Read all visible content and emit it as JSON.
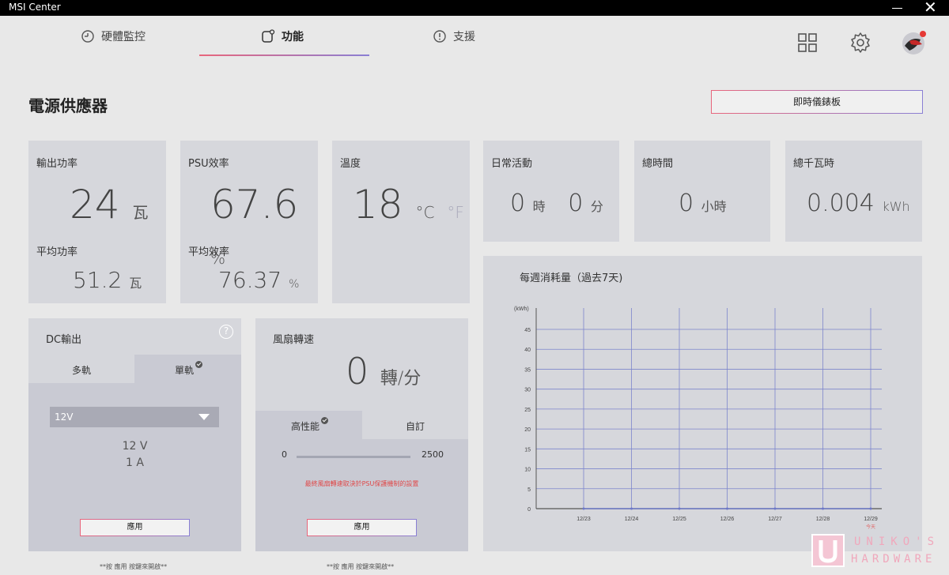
{
  "window": {
    "title": "MSI Center"
  },
  "nav": {
    "tabs": [
      {
        "label": "硬體監控",
        "icon": "gauge-icon"
      },
      {
        "label": "功能",
        "icon": "features-icon",
        "active": true
      },
      {
        "label": "支援",
        "icon": "support-icon"
      }
    ],
    "right_icons": [
      "apps-grid-icon",
      "settings-gear-icon",
      "user-avatar-icon"
    ]
  },
  "page": {
    "title": "電源供應器",
    "dashboard_button": "即時儀錶板"
  },
  "output_power": {
    "label": "輸出功率",
    "value": "24",
    "unit": "瓦",
    "avg_label": "平均功率",
    "avg_value": "51.2",
    "avg_unit": "瓦"
  },
  "psu_efficiency": {
    "label": "PSU效率",
    "value": "67.6",
    "unit": "%",
    "avg_label": "平均效率",
    "avg_value": "76.37",
    "avg_unit": "%"
  },
  "temperature": {
    "label": "溫度",
    "value": "18",
    "unit_c": "°C",
    "unit_f": "°F"
  },
  "daily_activity": {
    "label": "日常活動",
    "hours": "0",
    "hours_unit": "時",
    "minutes": "0",
    "minutes_unit": "分"
  },
  "total_time": {
    "label": "總時間",
    "value": "0",
    "unit": "小時"
  },
  "total_kwh": {
    "label": "總千瓦時",
    "value": "0.004",
    "unit": "kWh"
  },
  "dc_output": {
    "label": "DC輸出",
    "tabs": [
      "多軌",
      "單軌"
    ],
    "selected_tab": "單軌",
    "rail_select": "12V",
    "voltage": "12 V",
    "current": "1 A",
    "apply": "應用",
    "note": "**按 應用 按鍵來開啟**"
  },
  "fan_speed": {
    "label": "風扇轉速",
    "value": "0",
    "unit": "轉/分",
    "tabs": [
      "高性能",
      "自訂"
    ],
    "selected_tab": "高性能",
    "slider_min": "0",
    "slider_max": "2500",
    "warning": "最終風扇轉速取決於PSU保護機制的設置",
    "apply": "應用",
    "note": "**按 應用 按鍵來開啟**"
  },
  "accent_colors": {
    "pink": "#e8667c",
    "violet": "#8a7fd4",
    "warning": "#e04848",
    "chart_line": "#6d78c8"
  },
  "chart_data": {
    "type": "line",
    "title": "每週消耗量（過去7天)",
    "ylabel": "(kWh)",
    "xlabel": "",
    "x": [
      "12/23",
      "12/24",
      "12/25",
      "12/26",
      "12/27",
      "12/28",
      "12/29"
    ],
    "today_label": "今天",
    "y_ticks": [
      "0",
      "5",
      "10",
      "15",
      "20",
      "25",
      "30",
      "35",
      "40",
      "45"
    ],
    "ylim": [
      0,
      45
    ],
    "series": [
      {
        "values": [
          0,
          0,
          0,
          0,
          0,
          0,
          0.004
        ]
      }
    ],
    "grid": true
  },
  "watermark": {
    "text_top": "UNIKO'S",
    "text_bottom": "HARDWARE"
  }
}
